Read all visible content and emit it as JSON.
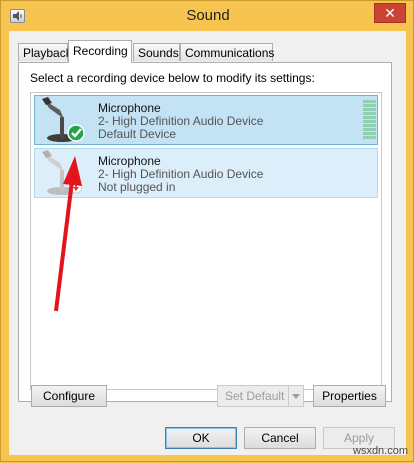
{
  "window": {
    "title": "Sound",
    "close_label": "✕"
  },
  "tabs": [
    {
      "label": "Playback"
    },
    {
      "label": "Recording"
    },
    {
      "label": "Sounds"
    },
    {
      "label": "Communications"
    }
  ],
  "instruction": "Select a recording device below to modify its settings:",
  "devices": [
    {
      "name": "Microphone",
      "driver": "2- High Definition Audio Device",
      "status": "Default Device",
      "icon": "microphone-icon",
      "badge": "check-icon",
      "badge_color": "#22a447",
      "selected": true
    },
    {
      "name": "Microphone",
      "driver": "2- High Definition Audio Device",
      "status": "Not plugged in",
      "icon": "microphone-icon",
      "badge": "unplugged-icon",
      "badge_color": "#d23b3b",
      "selected": false
    }
  ],
  "buttons": {
    "configure": "Configure",
    "set_default": "Set Default",
    "properties": "Properties",
    "ok": "OK",
    "cancel": "Cancel",
    "apply": "Apply"
  },
  "annotation": {
    "color": "#e3141b",
    "icon": "arrow-icon"
  },
  "watermark": "wsxdn.com",
  "colors": {
    "frame": "#f6c44f",
    "selection": "#c3e2f4",
    "close": "#c94435"
  }
}
